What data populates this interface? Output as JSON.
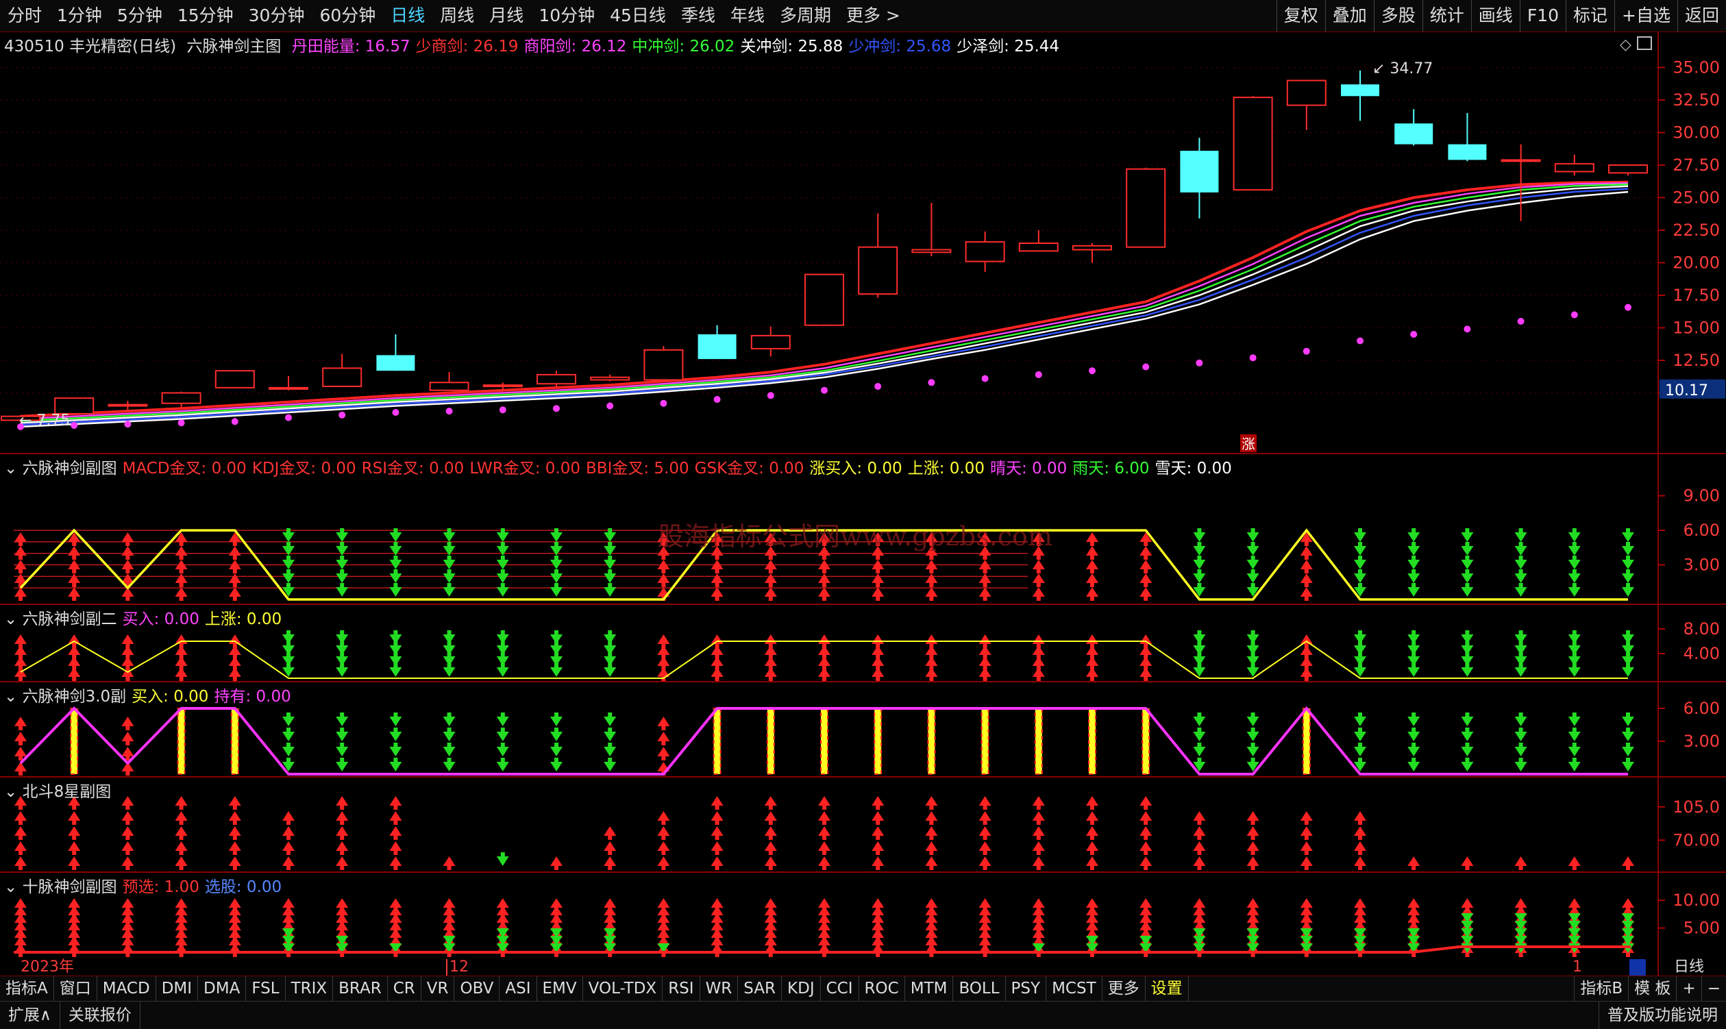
{
  "periods": [
    "分时",
    "1分钟",
    "5分钟",
    "15分钟",
    "30分钟",
    "60分钟",
    "日线",
    "周线",
    "月线",
    "10分钟",
    "45日线",
    "季线",
    "年线",
    "多周期",
    "更多 >"
  ],
  "active_period": "日线",
  "tools": [
    "复权",
    "叠加",
    "多股",
    "统计",
    "画线",
    "F10",
    "标记",
    "+自选",
    "返回"
  ],
  "header": {
    "stock": "430510 丰光精密(日线)",
    "indicator": "六脉神剑主图",
    "items": [
      {
        "label": "丹田能量: 16.57",
        "color": "#ff44ff"
      },
      {
        "label": "少商剑: 26.19",
        "color": "#ff3333"
      },
      {
        "label": "商阳剑: 26.12",
        "color": "#ff44ff"
      },
      {
        "label": "中冲剑: 26.02",
        "color": "#33ff33"
      },
      {
        "label": "关冲剑: 25.88",
        "color": "#ffffff"
      },
      {
        "label": "少冲剑: 25.68",
        "color": "#3355ff"
      },
      {
        "label": "少泽剑: 25.44",
        "color": "#ffffff"
      }
    ]
  },
  "sub1": {
    "title": "六脉神剑副图",
    "items": [
      {
        "label": "MACD金叉: 0.00",
        "color": "#ff3333"
      },
      {
        "label": "KDJ金叉: 0.00",
        "color": "#ff3333"
      },
      {
        "label": "RSI金叉: 0.00",
        "color": "#ff3333"
      },
      {
        "label": "LWR金叉: 0.00",
        "color": "#ff3333"
      },
      {
        "label": "BBI金叉: 5.00",
        "color": "#ff3333"
      },
      {
        "label": "GSK金叉: 0.00",
        "color": "#ff3333"
      },
      {
        "label": "涨买入: 0.00",
        "color": "#ffff33"
      },
      {
        "label": "上涨: 0.00",
        "color": "#ffff33"
      },
      {
        "label": "晴天: 0.00",
        "color": "#ff44ff"
      },
      {
        "label": "雨天: 6.00",
        "color": "#33ff33"
      },
      {
        "label": "雪天: 0.00",
        "color": "#ffffff"
      }
    ],
    "ticks": [
      "9.00",
      "6.00",
      "3.00"
    ]
  },
  "sub2": {
    "title": "六脉神剑副二",
    "items": [
      {
        "label": "买入: 0.00",
        "color": "#ff44ff"
      },
      {
        "label": "上涨: 0.00",
        "color": "#ffff33"
      }
    ],
    "ticks": [
      "8.00",
      "4.00"
    ]
  },
  "sub3": {
    "title": "六脉神剑3.0副",
    "items": [
      {
        "label": "买入: 0.00",
        "color": "#ffff33"
      },
      {
        "label": "持有: 0.00",
        "color": "#ff44ff"
      }
    ],
    "ticks": [
      "6.00",
      "3.00"
    ]
  },
  "sub4": {
    "title": "北斗8星副图",
    "items": [],
    "ticks": [
      "105.0",
      "70.00"
    ]
  },
  "sub5": {
    "title": "十脉神剑副图",
    "items": [
      {
        "label": "预选: 1.00",
        "color": "#ff3333"
      },
      {
        "label": "选股: 0.00",
        "color": "#5588ff"
      }
    ],
    "ticks": [
      "10.00",
      "5.00"
    ]
  },
  "watermark": "股海指标公式网www.gpzbs.com",
  "axis_dates": {
    "year": "2023年",
    "month": "12",
    "tail": "1"
  },
  "price_badge": "10.17",
  "high_label": "34.77",
  "low_label": "7.75",
  "zhang_label": "涨",
  "period_label": "日线",
  "bottom_tabs": [
    "指标A",
    "窗口",
    "MACD",
    "DMI",
    "DMA",
    "FSL",
    "TRIX",
    "BRAR",
    "CR",
    "VR",
    "OBV",
    "ASI",
    "EMV",
    "VOL-TDX",
    "RSI",
    "WR",
    "SAR",
    "KDJ",
    "CCI",
    "ROC",
    "MTM",
    "BOLL",
    "PSY",
    "MCST",
    "更多",
    "设置"
  ],
  "bottom_right": [
    "指标B",
    "模 板",
    "+",
    "−"
  ],
  "status": [
    "扩展∧",
    "关联报价"
  ],
  "status_right": "普及版功能说明",
  "chart_data": {
    "type": "candlestick",
    "y_ticks": [
      35.0,
      32.5,
      30.0,
      27.5,
      25.0,
      22.5,
      20.0,
      17.5,
      15.0,
      12.5,
      10.0
    ],
    "ylim": [
      6.5,
      36.5
    ],
    "candles": [
      {
        "o": 7.9,
        "h": 8.3,
        "l": 7.75,
        "c": 8.2
      },
      {
        "o": 8.4,
        "h": 9.6,
        "l": 8.3,
        "c": 9.6
      },
      {
        "o": 9.1,
        "h": 9.4,
        "l": 8.6,
        "c": 9.1
      },
      {
        "o": 9.2,
        "h": 10.1,
        "l": 8.9,
        "c": 10.0
      },
      {
        "o": 10.4,
        "h": 11.7,
        "l": 10.4,
        "c": 11.7
      },
      {
        "o": 10.4,
        "h": 11.3,
        "l": 10.2,
        "c": 10.4
      },
      {
        "o": 10.5,
        "h": 13.0,
        "l": 10.5,
        "c": 11.9
      },
      {
        "o": 12.9,
        "h": 14.5,
        "l": 11.7,
        "c": 11.7
      },
      {
        "o": 10.2,
        "h": 11.6,
        "l": 10.2,
        "c": 10.8
      },
      {
        "o": 10.5,
        "h": 10.8,
        "l": 10.2,
        "c": 10.6
      },
      {
        "o": 10.7,
        "h": 11.7,
        "l": 10.4,
        "c": 11.4
      },
      {
        "o": 11.0,
        "h": 11.4,
        "l": 10.9,
        "c": 11.2
      },
      {
        "o": 11.0,
        "h": 13.6,
        "l": 11.0,
        "c": 13.3
      },
      {
        "o": 14.5,
        "h": 15.2,
        "l": 12.6,
        "c": 12.6
      },
      {
        "o": 13.4,
        "h": 15.1,
        "l": 12.8,
        "c": 14.4
      },
      {
        "o": 15.2,
        "h": 19.1,
        "l": 15.2,
        "c": 19.1
      },
      {
        "o": 17.6,
        "h": 23.8,
        "l": 17.3,
        "c": 21.2
      },
      {
        "o": 20.8,
        "h": 24.6,
        "l": 20.5,
        "c": 21.0
      },
      {
        "o": 20.1,
        "h": 22.4,
        "l": 19.3,
        "c": 21.6
      },
      {
        "o": 20.9,
        "h": 22.5,
        "l": 20.9,
        "c": 21.5
      },
      {
        "o": 21.0,
        "h": 21.5,
        "l": 20.0,
        "c": 21.3
      },
      {
        "o": 21.2,
        "h": 27.3,
        "l": 21.2,
        "c": 27.2
      },
      {
        "o": 28.6,
        "h": 29.6,
        "l": 23.4,
        "c": 25.4
      },
      {
        "o": 25.6,
        "h": 32.8,
        "l": 25.6,
        "c": 32.7
      },
      {
        "o": 32.1,
        "h": 34.0,
        "l": 30.2,
        "c": 34.0
      },
      {
        "o": 33.7,
        "h": 34.77,
        "l": 30.9,
        "c": 32.8
      },
      {
        "o": 30.7,
        "h": 31.8,
        "l": 29.0,
        "c": 29.1
      },
      {
        "o": 29.1,
        "h": 31.5,
        "l": 27.8,
        "c": 27.9
      },
      {
        "o": 27.8,
        "h": 29.1,
        "l": 23.2,
        "c": 27.9
      },
      {
        "o": 27.0,
        "h": 28.3,
        "l": 26.7,
        "c": 27.6
      },
      {
        "o": 26.9,
        "h": 27.5,
        "l": 26.7,
        "c": 27.5
      }
    ],
    "series": [
      {
        "name": "少商剑",
        "color": "#ff2222",
        "values": [
          8.2,
          8.4,
          8.6,
          8.8,
          9.05,
          9.3,
          9.55,
          9.8,
          10.0,
          10.2,
          10.4,
          10.6,
          10.9,
          11.2,
          11.6,
          12.2,
          13.0,
          13.8,
          14.6,
          15.4,
          16.2,
          17.0,
          18.6,
          20.4,
          22.4,
          24.0,
          25.0,
          25.6,
          26.0,
          26.15,
          26.19
        ]
      },
      {
        "name": "商阳剑",
        "color": "#ff44ff",
        "values": [
          8.0,
          8.2,
          8.4,
          8.6,
          8.85,
          9.1,
          9.35,
          9.6,
          9.8,
          10.0,
          10.2,
          10.4,
          10.7,
          11.0,
          11.35,
          11.9,
          12.7,
          13.5,
          14.3,
          15.1,
          15.9,
          16.7,
          18.2,
          19.9,
          21.9,
          23.6,
          24.6,
          25.3,
          25.8,
          26.05,
          26.12
        ]
      },
      {
        "name": "中冲剑",
        "color": "#33ff33",
        "values": [
          7.85,
          8.05,
          8.25,
          8.45,
          8.7,
          8.95,
          9.2,
          9.45,
          9.65,
          9.85,
          10.05,
          10.25,
          10.55,
          10.85,
          11.2,
          11.7,
          12.45,
          13.25,
          14.05,
          14.85,
          15.65,
          16.45,
          17.85,
          19.5,
          21.4,
          23.2,
          24.3,
          25.0,
          25.6,
          25.9,
          26.02
        ]
      },
      {
        "name": "关冲剑",
        "color": "#ffffff",
        "values": [
          7.7,
          7.9,
          8.1,
          8.3,
          8.55,
          8.8,
          9.05,
          9.3,
          9.5,
          9.7,
          9.9,
          10.1,
          10.4,
          10.7,
          11.05,
          11.55,
          12.25,
          13.0,
          13.8,
          14.6,
          15.4,
          16.2,
          17.5,
          19.1,
          20.9,
          22.8,
          24.0,
          24.7,
          25.3,
          25.7,
          25.88
        ]
      },
      {
        "name": "少冲剑",
        "color": "#3355ff",
        "values": [
          7.55,
          7.75,
          7.95,
          8.15,
          8.4,
          8.65,
          8.9,
          9.15,
          9.35,
          9.55,
          9.75,
          9.95,
          10.25,
          10.55,
          10.9,
          11.4,
          12.05,
          12.8,
          13.55,
          14.35,
          15.15,
          15.95,
          17.15,
          18.7,
          20.4,
          22.3,
          23.6,
          24.4,
          25.0,
          25.45,
          25.68
        ]
      },
      {
        "name": "少泽剑",
        "color": "#ffffff",
        "values": [
          7.4,
          7.6,
          7.8,
          8.0,
          8.25,
          8.5,
          8.75,
          9.0,
          9.2,
          9.4,
          9.6,
          9.8,
          10.1,
          10.4,
          10.75,
          11.2,
          11.85,
          12.6,
          13.3,
          14.1,
          14.9,
          15.7,
          16.8,
          18.3,
          19.9,
          21.8,
          23.2,
          24.0,
          24.6,
          25.1,
          25.44
        ]
      }
    ],
    "dantian": [
      7.4,
      7.5,
      7.6,
      7.7,
      7.8,
      8.1,
      8.3,
      8.5,
      8.6,
      8.7,
      8.8,
      9.0,
      9.2,
      9.5,
      9.8,
      10.2,
      10.5,
      10.8,
      11.1,
      11.4,
      11.7,
      12.0,
      12.3,
      12.7,
      13.2,
      14.0,
      14.5,
      14.9,
      15.5,
      16.0,
      16.57
    ],
    "sub1_yellow": [
      1,
      6,
      1,
      6,
      6,
      0,
      0,
      0,
      0,
      0,
      0,
      0,
      0,
      6,
      6,
      6,
      6,
      6,
      6,
      6,
      6,
      6,
      0,
      0,
      6,
      0,
      0,
      0,
      0,
      0,
      0
    ],
    "sub2_yellow": [
      1,
      6,
      1,
      6,
      6,
      0,
      0,
      0,
      0,
      0,
      0,
      0,
      0,
      6,
      6,
      6,
      6,
      6,
      6,
      6,
      6,
      6,
      0,
      0,
      6,
      0,
      0,
      0,
      0,
      0,
      0
    ],
    "sub3_magenta": [
      1,
      6,
      1,
      6,
      6,
      0,
      0,
      0,
      0,
      0,
      0,
      0,
      0,
      6,
      6,
      6,
      6,
      6,
      6,
      6,
      6,
      6,
      0,
      0,
      6,
      0,
      0,
      0,
      0,
      0,
      0
    ],
    "signal_up": [
      1,
      1,
      1,
      1,
      1,
      0,
      0,
      0,
      0,
      0,
      0,
      0,
      1,
      1,
      1,
      1,
      1,
      1,
      1,
      1,
      1,
      1,
      0,
      0,
      1,
      0,
      0,
      0,
      0,
      0,
      0
    ],
    "sub4_red": [
      5,
      5,
      5,
      5,
      5,
      4,
      5,
      5,
      1,
      0,
      1,
      3,
      4,
      5,
      5,
      5,
      5,
      5,
      5,
      5,
      5,
      5,
      4,
      4,
      4,
      4,
      1,
      1,
      1,
      1,
      1
    ],
    "sub5_red": [
      5,
      5,
      5,
      5,
      5,
      2,
      3,
      4,
      3,
      2,
      2,
      2,
      4,
      5,
      5,
      5,
      5,
      5,
      5,
      4,
      3,
      3,
      2,
      2,
      2,
      2,
      2,
      0,
      0,
      0,
      0
    ]
  }
}
